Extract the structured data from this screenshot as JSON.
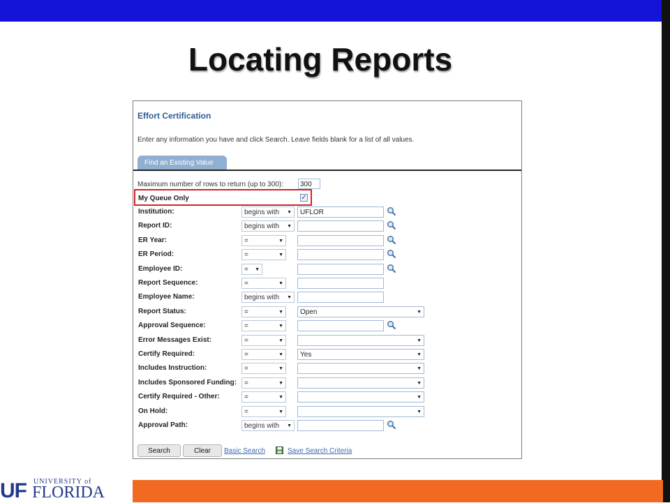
{
  "slide": {
    "title": "Locating Reports"
  },
  "panel": {
    "title": "Effort Certification",
    "instructions": "Enter any information you have and click Search. Leave fields blank for a list of all values.",
    "tab_label": "Find an Existing Value",
    "max_rows_label": "Maximum number of rows to return (up to 300):",
    "max_rows_value": "300",
    "my_queue_label": "My Queue Only",
    "my_queue_checked": "✓",
    "rows": [
      {
        "label": "Institution:",
        "operator": "begins with",
        "value": "UFLOR",
        "lookup": true
      },
      {
        "label": "Report ID:",
        "operator": "begins with",
        "value": "",
        "lookup": true
      },
      {
        "label": "ER Year:",
        "operator": "=",
        "value": "",
        "lookup": true
      },
      {
        "label": "ER Period:",
        "operator": "=",
        "value": "",
        "lookup": true
      },
      {
        "label": "Employee ID:",
        "operator": "=",
        "value": "",
        "lookup": true
      },
      {
        "label": "Report Sequence:",
        "operator": "=",
        "value": ""
      },
      {
        "label": "Employee Name:",
        "operator": "begins with",
        "value": ""
      },
      {
        "label": "Report Status:",
        "operator": "=",
        "value": "Open"
      },
      {
        "label": "Approval Sequence:",
        "operator": "=",
        "value": "",
        "lookup": true
      },
      {
        "label": "Error Messages Exist:",
        "operator": "=",
        "value": ""
      },
      {
        "label": "Certify Required:",
        "operator": "=",
        "value": "Yes"
      },
      {
        "label": "Includes Instruction:",
        "operator": "=",
        "value": ""
      },
      {
        "label": "Includes Sponsored Funding:",
        "operator": "=",
        "value": ""
      },
      {
        "label": "Certify Required - Other:",
        "operator": "=",
        "value": ""
      },
      {
        "label": "On Hold:",
        "operator": "=",
        "value": ""
      },
      {
        "label": "Approval Path:",
        "operator": "begins with",
        "value": "",
        "lookup": true
      }
    ],
    "buttons": {
      "search": "Search",
      "clear": "Clear"
    },
    "links": {
      "basic_search": "Basic Search",
      "save_criteria": "Save Search Criteria"
    }
  },
  "logo": {
    "uf": "UF",
    "university_of": "UNIVERSITY of",
    "florida": "FLORIDA"
  },
  "colors": {
    "top_bar": "#1414d8",
    "orange_bar": "#f26a21",
    "highlight": "#d61f28",
    "panel_title": "#2f5b96",
    "logo_blue": "#24398a"
  }
}
